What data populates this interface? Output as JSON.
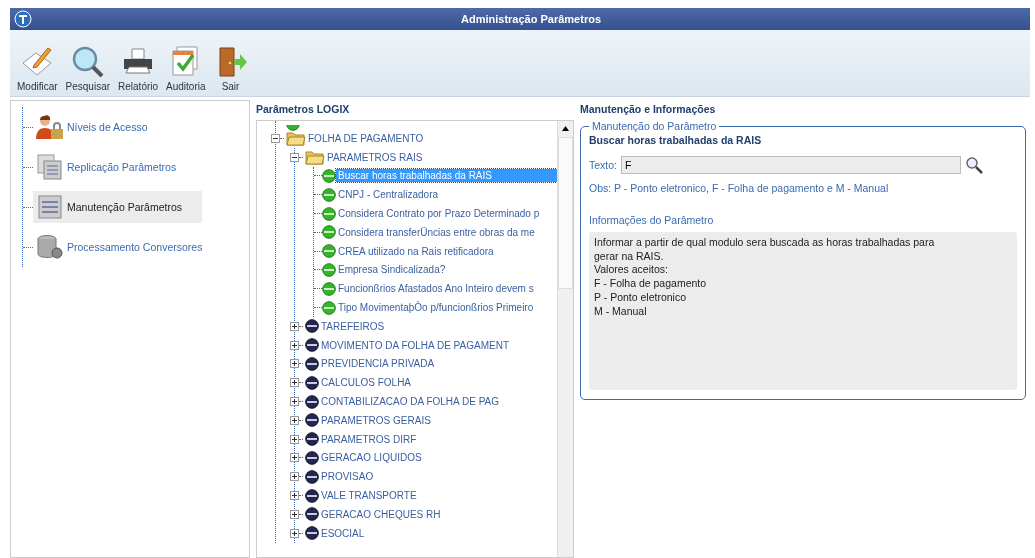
{
  "window": {
    "title": "Administração Parâmetros"
  },
  "toolbar": [
    {
      "label": "Modificar",
      "kind": "edit"
    },
    {
      "label": "Pesquisar",
      "kind": "search"
    },
    {
      "label": "Relatório",
      "kind": "print"
    },
    {
      "label": "Auditoria",
      "kind": "audit"
    },
    {
      "label": "Sair",
      "kind": "exit"
    }
  ],
  "nav": [
    {
      "label": "Níveis de Acesso",
      "kind": "user",
      "selected": false
    },
    {
      "label": "Replicação Parâmetros",
      "kind": "replicate",
      "selected": false
    },
    {
      "label": "Manutenção Parâmetros",
      "kind": "params",
      "selected": true
    },
    {
      "label": "Processamento Conversores",
      "kind": "database",
      "selected": false
    }
  ],
  "tree": {
    "title": "Parâmetros LOGIX",
    "items": [
      {
        "label": "FOLHA DE PAGAMENTO",
        "kind": "folder",
        "expanded": true,
        "selected": false,
        "children": [
          {
            "label": "PARAMETROS RAIS",
            "kind": "folder",
            "expanded": true,
            "selected": false,
            "children": [
              {
                "label": "Buscar horas trabalhadas da RAIS",
                "kind": "parameter",
                "selected": true
              },
              {
                "label": "CNPJ - Centralizadora",
                "kind": "parameter",
                "selected": false
              },
              {
                "label": "Considera Contrato por Prazo Determinado p",
                "kind": "parameter",
                "selected": false
              },
              {
                "label": "Considera transferÜncias entre obras da me",
                "kind": "parameter",
                "selected": false
              },
              {
                "label": "CREA utilizado na Rais retificadora",
                "kind": "parameter",
                "selected": false
              },
              {
                "label": "Empresa Sindicalizada?",
                "kind": "parameter",
                "selected": false
              },
              {
                "label": "Funcionßrios Afastados Ano Inteiro devem s",
                "kind": "parameter",
                "selected": false
              },
              {
                "label": "Tipo MovimentaþÒo p/funcionßrios Primeiro",
                "kind": "parameter",
                "selected": false
              }
            ]
          },
          {
            "label": "TAREFEIROS",
            "kind": "group",
            "expanded": false,
            "selected": false
          },
          {
            "label": "MOVIMENTO DA FOLHA DE PAGAMENT",
            "kind": "group",
            "expanded": false,
            "selected": false
          },
          {
            "label": "PREVIDENCIA PRIVADA",
            "kind": "group",
            "expanded": false,
            "selected": false
          },
          {
            "label": "CALCULOS FOLHA",
            "kind": "group",
            "expanded": false,
            "selected": false
          },
          {
            "label": "CONTABILIZACAO DA FOLHA DE PAG",
            "kind": "group",
            "expanded": false,
            "selected": false
          },
          {
            "label": "PARAMETROS GERAIS",
            "kind": "group",
            "expanded": false,
            "selected": false
          },
          {
            "label": "PARAMETROS DIRF",
            "kind": "group",
            "expanded": false,
            "selected": false
          },
          {
            "label": "GERACAO LIQUIDOS",
            "kind": "group",
            "expanded": false,
            "selected": false
          },
          {
            "label": "PROVISAO",
            "kind": "group",
            "expanded": false,
            "selected": false
          },
          {
            "label": "VALE TRANSPORTE",
            "kind": "group",
            "expanded": false,
            "selected": false
          },
          {
            "label": "GERACAO CHEQUES RH",
            "kind": "group",
            "expanded": false,
            "selected": false
          },
          {
            "label": "ESOCIAL",
            "kind": "group",
            "expanded": false,
            "selected": false
          }
        ]
      }
    ]
  },
  "details": {
    "title": "Manutenção e Informações",
    "legend": "Manutenção do Parâmetro",
    "parameter": "Buscar horas trabalhadas da RAIS",
    "field_label": "Texto:",
    "field_value": "F",
    "obs": "Obs: P - Ponto eletronico, F - Folha de pagamento e M - Manual",
    "info_label": "Informações do Parâmetro",
    "info_lines": [
      "Informar a partir de qual modulo sera buscada as horas trabalhadas para",
      "gerar na RAIS.",
      "Valores aceitos:",
      "F - Folha de pagamento",
      "P - Ponto eletronico",
      "M - Manual"
    ]
  }
}
